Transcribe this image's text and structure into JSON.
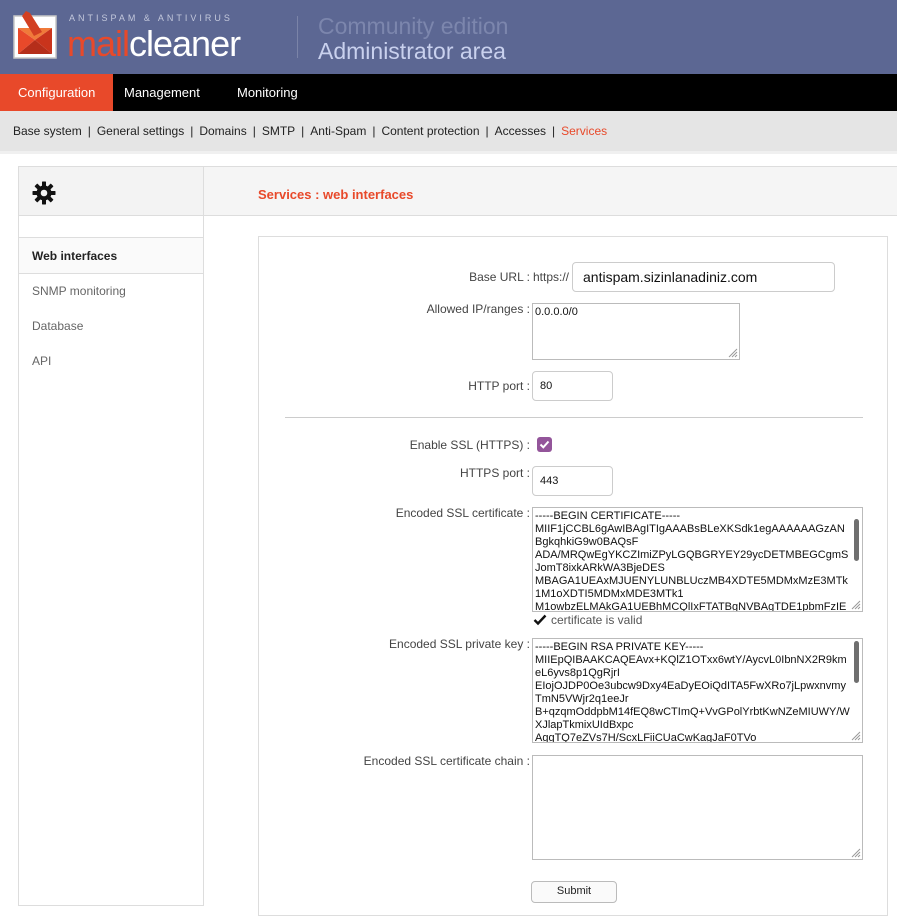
{
  "header": {
    "logo_tagline": "ANTISPAM & ANTIVIRUS",
    "logo_mail": "mail",
    "logo_cleaner": "cleaner",
    "edition": "Community edition",
    "area": "Administrator area"
  },
  "topnav": [
    {
      "label": "Configuration",
      "active": true
    },
    {
      "label": "Management",
      "active": false
    },
    {
      "label": "Monitoring",
      "active": false
    }
  ],
  "subnav": [
    {
      "label": "Base system"
    },
    {
      "label": "General settings"
    },
    {
      "label": "Domains"
    },
    {
      "label": "SMTP"
    },
    {
      "label": "Anti-Spam"
    },
    {
      "label": "Content protection"
    },
    {
      "label": "Accesses"
    },
    {
      "label": "Services",
      "active": true
    }
  ],
  "sidebar": {
    "icon": "gear-icon",
    "items": [
      {
        "label": "Web interfaces",
        "active": true
      },
      {
        "label": "SNMP monitoring"
      },
      {
        "label": "Database"
      },
      {
        "label": "API"
      }
    ]
  },
  "main": {
    "title": "Services : web interfaces"
  },
  "form": {
    "base_url_label": "Base URL :",
    "base_url_prefix": "https://",
    "base_url_value": "antispam.sizinlanadiniz.com",
    "allowed_ip_label": "Allowed IP/ranges :",
    "allowed_ip_value": "0.0.0.0/0",
    "http_port_label": "HTTP port :",
    "http_port_value": "80",
    "enable_ssl_label": "Enable SSL (HTTPS) :",
    "enable_ssl_checked": true,
    "https_port_label": "HTTPS port :",
    "https_port_value": "443",
    "cert_label": "Encoded SSL certificate :",
    "cert_value": "-----BEGIN CERTIFICATE-----\nMIIF1jCCBL6gAwIBAgITIgAAABsBLeXKSdk1egAAAAAAGzAN\nBgkqhkiG9w0BAQsF\nADA/MRQwEgYKCZImiZPyLGQBGRYEY29ycDETMBEGCgmS\nJomT8ixkARkWA3BjeDES\nMBAGA1UEAxMJUENYLUNBLUczMB4XDTE5MDMxMzE3MTk\n1M1oXDTI5MDMxMDE3MTk1\nM1owbzELMAkGA1UEBhMCQlIxFTATBgNVBAgTDE1pbmFzIE",
    "cert_status": "certificate is valid",
    "key_label": "Encoded SSL private key :",
    "key_value": "-----BEGIN RSA PRIVATE KEY-----\nMIIEpQIBAAKCAQEAvx+KQlZ1OTxx6wtY/AycvL0IbnNX2R9km\neL6yvs8p1QgRjrI\nEIojOJDP0Oe3ubcw9Dxy4EaDyEOiQdITA5FwXRo7jLpwxnvmy\nTmN5VWjr2q1eeJr\nB+qzqmOddpbM14fEQ8wCTImQ+VvGPolYrbtKwNZeMIUWY/W\nXJlapTkmixUIdBxpc\nAggTQ7eZVs7H/ScxLFiiCUaCwKagJaF0TVo",
    "chain_label": "Encoded SSL certificate chain :",
    "chain_value": "",
    "submit_label": "Submit"
  },
  "colors": {
    "header_bg": "#5c6793",
    "accent": "#e8492a",
    "nav_bg": "#000000",
    "subnav_bg": "#e5e5e5",
    "checkbox": "#93559a"
  }
}
